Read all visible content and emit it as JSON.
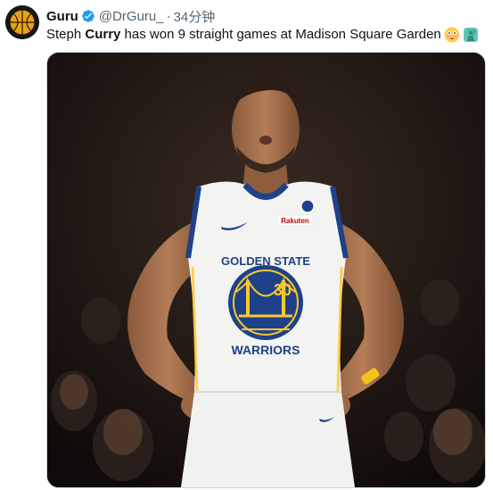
{
  "tweet": {
    "author_name": "Guru",
    "author_handle": "@DrGuru_",
    "separator": "·",
    "time_ago": "34分钟",
    "text_before": "Steph ",
    "text_bold": "Curry",
    "text_after": " has won 9 straight games at Madison Square Garden",
    "emojis": [
      "flushed-face-emoji",
      "statue-of-liberty-emoji"
    ],
    "verified_badge_color": "#1d9bf0"
  },
  "media": {
    "jersey_team": "GOLDEN STATE",
    "jersey_name": "WARRIORS",
    "jersey_number": "30",
    "sponsor": "Rakuten",
    "colors": {
      "jersey": "#f3f3f1",
      "trim_blue": "#1d428a",
      "gold": "#ffc72c"
    }
  }
}
